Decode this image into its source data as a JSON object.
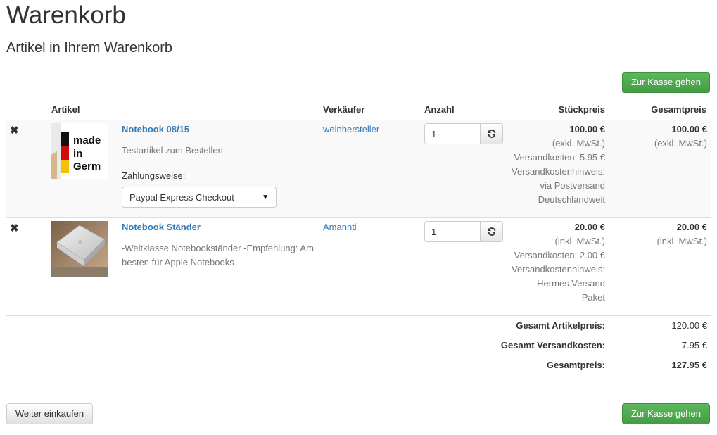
{
  "page": {
    "title": "Warenkorb",
    "subtitle": "Artikel in Ihrem Warenkorb",
    "checkout_label": "Zur Kasse gehen",
    "continue_label": "Weiter einkaufen"
  },
  "table": {
    "headers": {
      "article": "Artikel",
      "seller": "Verkäufer",
      "quantity": "Anzahl",
      "unit_price": "Stückpreis",
      "total_price": "Gesamtpreis"
    }
  },
  "items": [
    {
      "remove_icon": "✖",
      "image_text": [
        "made",
        "in",
        "Germ"
      ],
      "title": "Notebook 08/15",
      "description": "Testartikel zum Bestellen",
      "payment_label": "Zahlungsweise:",
      "payment_selected": "Paypal Express Checkout",
      "seller": "weinhersteller",
      "quantity": "1",
      "unit_price": "100.00 €",
      "unit_tax": "(exkl. MwSt.)",
      "shipping": "Versandkosten: 5.95 €",
      "shipping_note_label": "Versandkostenhinweis:",
      "shipping_note_line1": "via Postversand",
      "shipping_note_line2": "Deutschlandweit",
      "total_price": "100.00 €",
      "total_tax": "(exkl. MwSt.)"
    },
    {
      "remove_icon": "✖",
      "title": "Notebook Ständer",
      "description": "-Weltklasse Notebookständer -Empfehlung: Am besten für Apple Notebooks",
      "seller": "Amannti",
      "quantity": "1",
      "unit_price": "20.00 €",
      "unit_tax": "(inkl. MwSt.)",
      "shipping": "Versandkosten: 2.00 €",
      "shipping_note_label": "Versandkostenhinweis:",
      "shipping_note_line1": "Hermes Versand",
      "shipping_note_line2": "Paket",
      "total_price": "20.00 €",
      "total_tax": "(inkl. MwSt.)"
    }
  ],
  "totals": {
    "items_label": "Gesamt Artikelpreis:",
    "items_value": "120.00 €",
    "shipping_label": "Gesamt Versandkosten:",
    "shipping_value": "7.95 €",
    "grand_label": "Gesamtpreis:",
    "grand_value": "127.95 €"
  },
  "icons": {
    "remove": "remove-icon",
    "refresh": "refresh-icon",
    "caret": "chevron-down-icon"
  },
  "colors": {
    "success": "#5cb85c",
    "link": "#337ab7",
    "row_stripe": "#f9f9f9"
  }
}
